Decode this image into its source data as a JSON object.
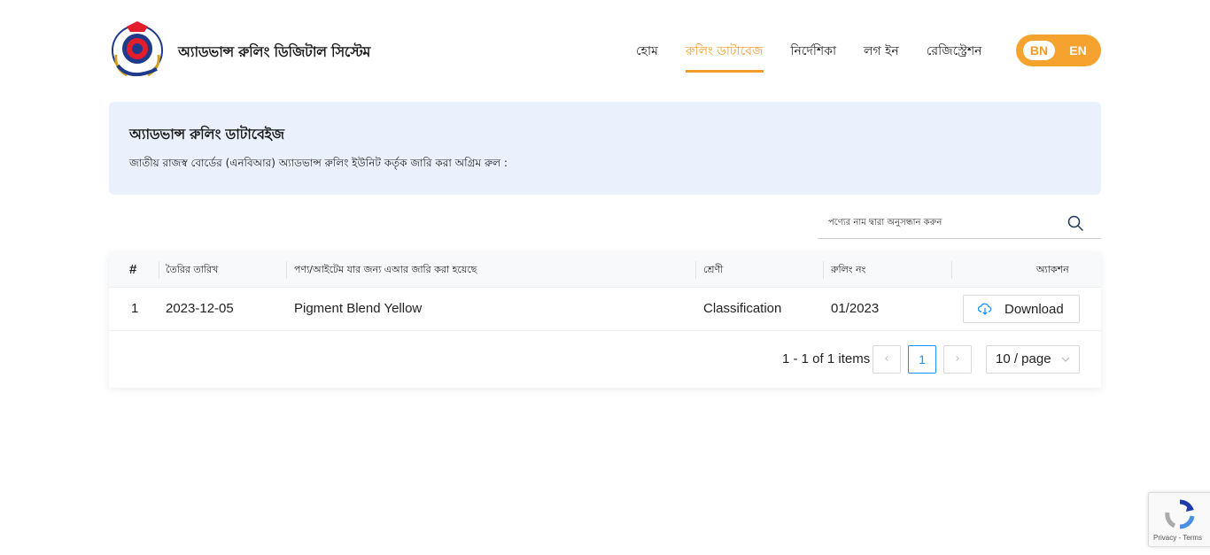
{
  "header": {
    "site_title": "অ্যাডভান্স রুলিং ডিজিটাল সিস্টেম",
    "logo_text": "BANGLADESH CUSTOMS & VAT",
    "nav": [
      {
        "label": "হোম",
        "active": false
      },
      {
        "label": "রুলিং ডাটাবেজ",
        "active": true
      },
      {
        "label": "নির্দেশিকা",
        "active": false
      },
      {
        "label": "লগ ইন",
        "active": false
      },
      {
        "label": "রেজিস্ট্রেশন",
        "active": false
      }
    ],
    "lang": {
      "bn": "BN",
      "en": "EN",
      "selected": "BN"
    },
    "accent_color": "#f39c2a"
  },
  "info": {
    "title": "অ্যাডভান্স রুলিং ডাটাবেইজ",
    "subtitle": "জাতীয় রাজস্ব বোর্ডের (এনবিআর) অ্যাডভান্স রুলিং ইউনিট কর্তৃক জারি করা অগ্রিম রুল :"
  },
  "search": {
    "placeholder": "পণ্যের নাম দ্বারা অনুসন্ধান করুন",
    "value": ""
  },
  "table": {
    "columns": [
      "#",
      "তৈরির তারিখ",
      "পণ্য/আইটেম যার জন্য এআর জারি করা হয়েছে",
      "শ্রেণী",
      "রুলিং নং",
      "অ্যাকশন"
    ],
    "rows": [
      {
        "index": "1",
        "date": "2023-12-05",
        "item": "Pigment Blend Yellow",
        "category": "Classification",
        "ruling_no": "01/2023",
        "action_label": "Download"
      }
    ]
  },
  "pagination": {
    "total_text": "1 - 1 of 1 items",
    "prev": "‹",
    "current_page": "1",
    "next": "›",
    "page_size": "10 / page"
  },
  "recaptcha": {
    "links": "Privacy - Terms"
  }
}
